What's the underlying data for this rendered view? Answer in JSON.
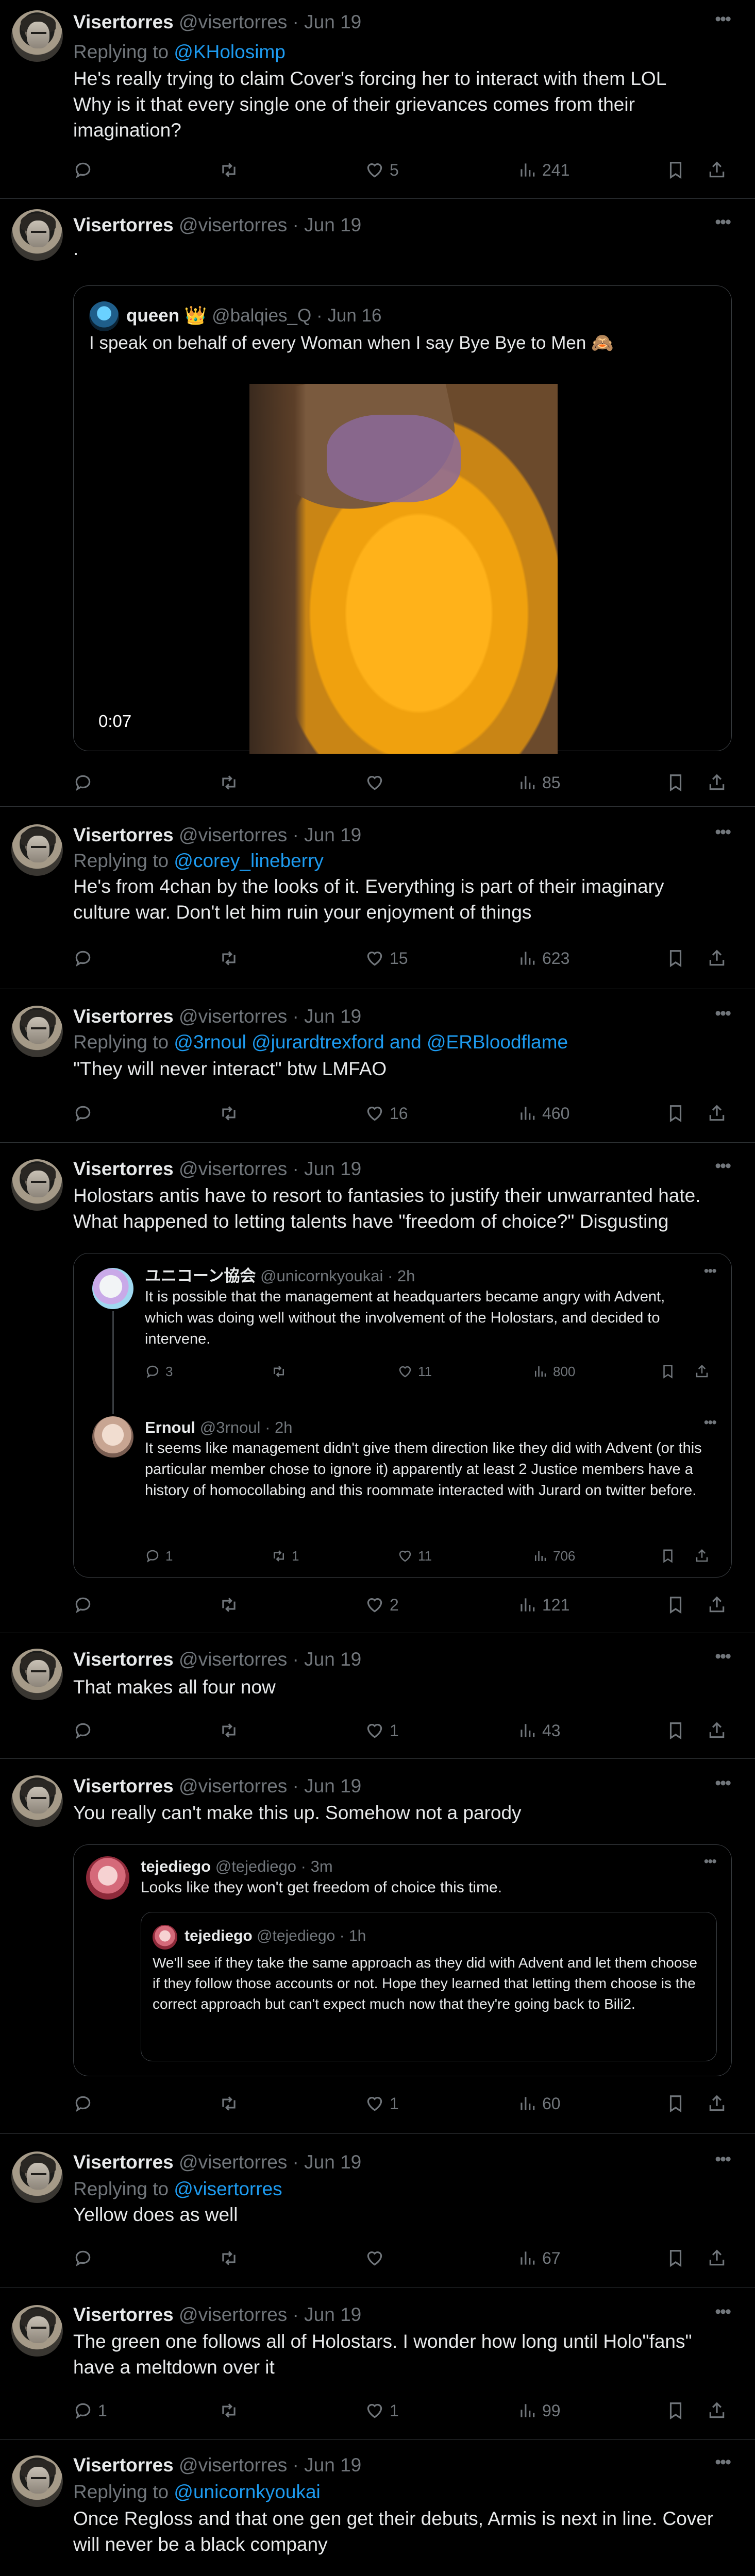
{
  "tweets": [
    {
      "name": "Visertorres",
      "handle": "@visertorres",
      "date": "Jun 19",
      "replying_label": "Replying to",
      "replying_to": "@KHolosimp",
      "text": "He's really trying to claim Cover's forcing her to interact with them LOL\nWhy is it that every single one of their grievances comes from their imagination?",
      "replies": "",
      "retweets": "",
      "likes": "5",
      "views": "241"
    },
    {
      "name": "Visertorres",
      "handle": "@visertorres",
      "date": "Jun 19",
      "text": ".",
      "replies": "",
      "retweets": "",
      "likes": "",
      "views": "85",
      "quote": {
        "name": "queen 👑",
        "handle": "@balqies_Q",
        "date": "Jun 16",
        "text": "I speak on behalf of every Woman when I say Bye Bye to Men 🙈",
        "video_time": "0:07"
      }
    },
    {
      "name": "Visertorres",
      "handle": "@visertorres",
      "date": "Jun 19",
      "replying_label": "Replying to",
      "replying_to": "@corey_lineberry",
      "text": "He's from 4chan by the looks of it. Everything is part of their imaginary culture war. Don't let him ruin your enjoyment of things",
      "replies": "",
      "retweets": "",
      "likes": "15",
      "views": "623"
    },
    {
      "name": "Visertorres",
      "handle": "@visertorres",
      "date": "Jun 19",
      "replying_label": "Replying to",
      "replying_to": "@3rnoul @jurardtrexford and @ERBloodflame",
      "text": "\"They will never interact\" btw LMFAO",
      "replies": "",
      "retweets": "",
      "likes": "16",
      "views": "460"
    },
    {
      "name": "Visertorres",
      "handle": "@visertorres",
      "date": "Jun 19",
      "text": "Holostars antis have to resort to fantasies to justify their unwarranted hate. What happened to letting talents have \"freedom of choice?\" Disgusting",
      "replies": "",
      "retweets": "",
      "likes": "2",
      "views": "121",
      "quote_thread": [
        {
          "name": "ユニコーン協会",
          "handle": "@unicornkyoukai",
          "date": "2h",
          "text": "It is possible that the management at headquarters became angry with Advent, which was doing well without the involvement of the Holostars, and decided to intervene.",
          "replies": "3",
          "retweets": "",
          "likes": "11",
          "views": "800"
        },
        {
          "name": "Ernoul",
          "handle": "@3rnoul",
          "date": "2h",
          "text": "It seems like management didn't give them direction like they did with Advent (or this particular member chose to ignore it) apparently at least 2 Justice members have a history of homocollabing and this roommate interacted with Jurard on twitter before.",
          "replies": "1",
          "retweets": "1",
          "likes": "11",
          "views": "706"
        }
      ]
    },
    {
      "name": "Visertorres",
      "handle": "@visertorres",
      "date": "Jun 19",
      "text": "That makes all four now",
      "replies": "",
      "retweets": "",
      "likes": "1",
      "views": "43"
    },
    {
      "name": "Visertorres",
      "handle": "@visertorres",
      "date": "Jun 19",
      "text": "You really can't make this up. Somehow not a parody",
      "replies": "",
      "retweets": "",
      "likes": "1",
      "views": "60",
      "nested_quote": {
        "name": "tejediego",
        "handle": "@tejediego",
        "date": "3m",
        "text": "Looks like they won't get freedom of choice this time.",
        "inner": {
          "name": "tejediego",
          "handle": "@tejediego",
          "date": "1h",
          "text": "We'll see if they take the same approach as they did with Advent and let them choose if they follow those accounts or not. Hope they learned that letting them choose is the correct approach but can't expect much now that they're going back to Bili2."
        }
      }
    },
    {
      "name": "Visertorres",
      "handle": "@visertorres",
      "date": "Jun 19",
      "replying_label": "Replying to",
      "replying_to": "@visertorres",
      "text": "Yellow does as well",
      "replies": "",
      "retweets": "",
      "likes": "",
      "views": "67"
    },
    {
      "name": "Visertorres",
      "handle": "@visertorres",
      "date": "Jun 19",
      "text": "The green one follows all of Holostars. I wonder how long until Holo\"fans\" have a meltdown over it",
      "replies": "1",
      "retweets": "",
      "likes": "1",
      "views": "99"
    },
    {
      "name": "Visertorres",
      "handle": "@visertorres",
      "date": "Jun 19",
      "replying_label": "Replying to",
      "replying_to": "@unicornkyoukai",
      "text": "Once Regloss and that one gen get their debuts, Armis is next in line. Cover will never be a black company"
    }
  ],
  "colors": {
    "bg": "#000000",
    "text": "#e7e9ea",
    "muted": "#71767b",
    "link": "#1d9bf0",
    "border": "#2f3336"
  }
}
